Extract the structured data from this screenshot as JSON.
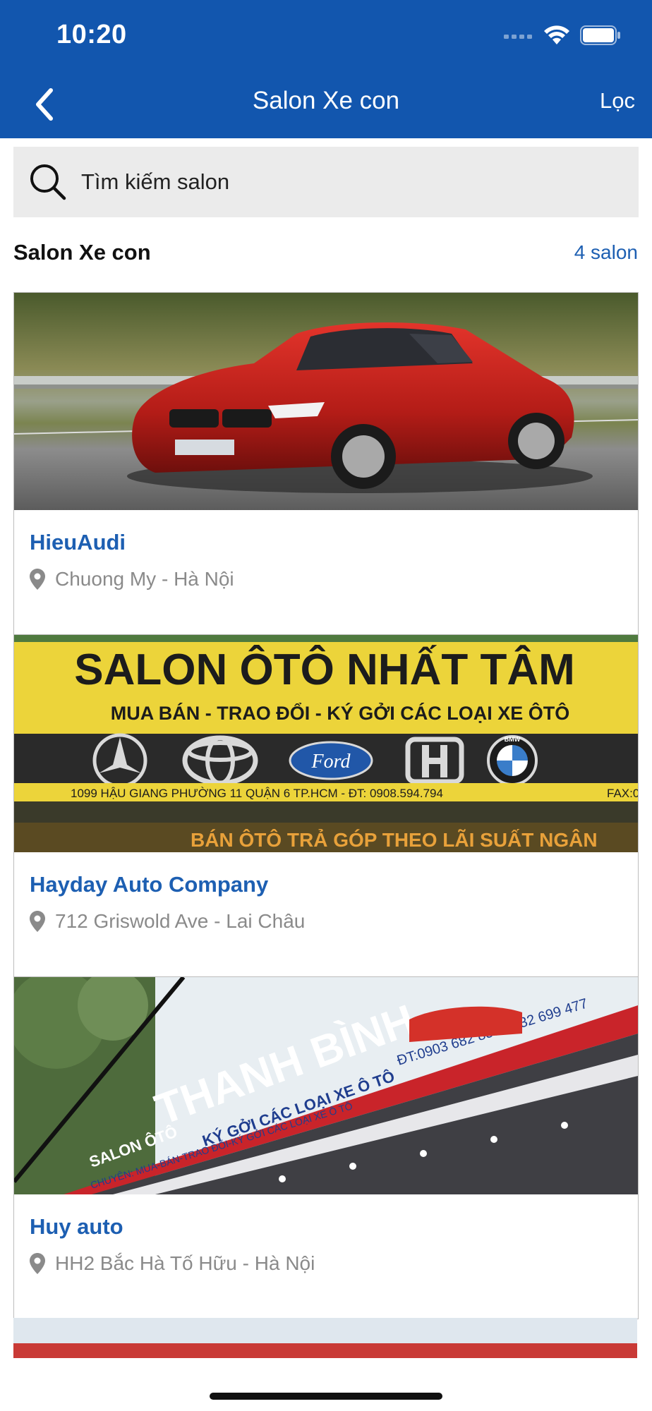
{
  "status_bar": {
    "time": "10:20"
  },
  "nav": {
    "title": "Salon Xe con",
    "filter_label": "Lọc"
  },
  "search": {
    "placeholder": "Tìm kiếm salon"
  },
  "section": {
    "title": "Salon Xe con",
    "count": "4 salon"
  },
  "salons": [
    {
      "name": "HieuAudi",
      "address": "Chuong My - Hà Nội"
    },
    {
      "name": "Hayday Auto Company",
      "address": "712 Griswold Ave - Lai Châu"
    },
    {
      "name": "Huy auto",
      "address": "HH2 Bắc Hà Tố Hữu - Hà Nội"
    }
  ],
  "signs": {
    "nhat_tam": {
      "title": "SALON ÔTÔ NHẤT TÂM",
      "subtitle": "MUA BÁN - TRAO ĐỔI - KÝ GỞI CÁC LOẠI XE ÔTÔ",
      "ford": "Ford",
      "bmw": "BMW",
      "address": "1099 HẬU GIANG PHƯỜNG 11 QUẬN 6 TP.HCM - ĐT: 0908.594.794",
      "fax": "FAX:0",
      "bottom": "BÁN ÔTÔ TRẢ GÓP THEO LÃI SUẤT NGÂN"
    },
    "thanh_binh": {
      "name": "THANH BÌNH",
      "prefix": "SALON ÔTÔ",
      "tagline": "KÝ GỞI CÁC LOẠI XE Ô TÔ",
      "phone": "ĐT:0903 682 857-0932 699 477",
      "services": "CHUYÊN: MUA-BÁN-TRAO ĐỔI-KÝ GỞI CÁC LOẠI XE Ô TÔ"
    }
  },
  "colors": {
    "brand": "#1256ae",
    "link": "#1d5fb2",
    "muted": "#8a8a8a"
  }
}
